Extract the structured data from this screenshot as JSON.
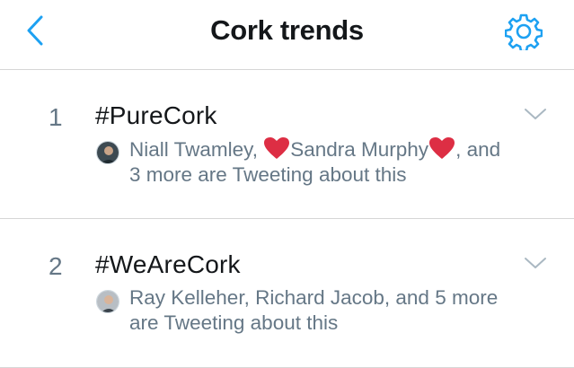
{
  "header": {
    "title": "Cork trends",
    "accent_color": "#1da1f2",
    "back_icon": "chevron-left-icon",
    "settings_icon": "gear-icon"
  },
  "trends": [
    {
      "rank": "1",
      "hashtag": "#PureCork",
      "context_part1": "Niall Twamley, ",
      "context_part2": "Sandra Murphy",
      "context_part3": ", and",
      "context_part4": "3 more are Tweeting about this"
    },
    {
      "rank": "2",
      "hashtag": "#WeAreCork",
      "context_line1": "Ray Kelleher, Richard Jacob, and 5 more",
      "context_line2": "are Tweeting about this"
    }
  ]
}
